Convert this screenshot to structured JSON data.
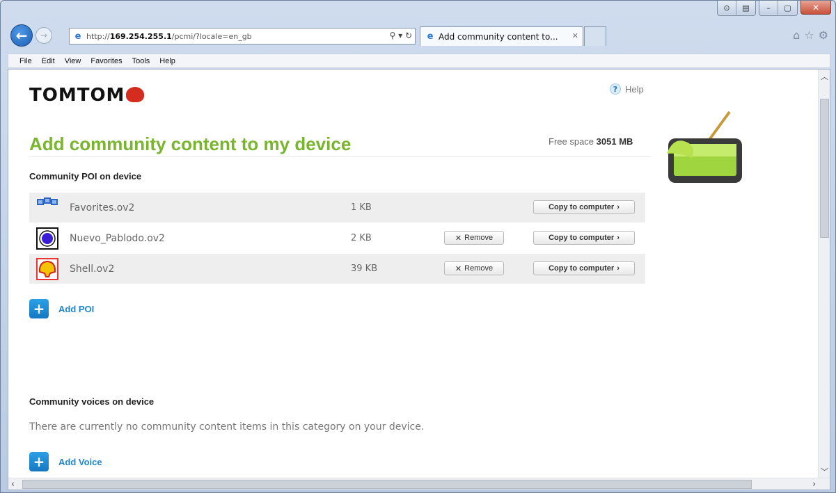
{
  "browser": {
    "address_prefix": "http://",
    "address_host": "169.254.255.1",
    "address_path": "/pcmi/?locale=en_gb",
    "tab_title": "Add community content to...",
    "menu": [
      "File",
      "Edit",
      "View",
      "Favorites",
      "Tools",
      "Help"
    ]
  },
  "page": {
    "logo": "TOMTOM",
    "help": "Help",
    "title": "Add community content to my device",
    "free_space_label": "Free space",
    "free_space_value": "3051 MB",
    "poi_section": "Community POI on device",
    "poi_items": [
      {
        "name": "Favorites.ov2",
        "size": "1 KB",
        "icon": "favorites-poi-icon",
        "removable": false
      },
      {
        "name": "Nuevo_Pablodo.ov2",
        "size": "2 KB",
        "icon": "circle-poi-icon",
        "removable": true
      },
      {
        "name": "Shell.ov2",
        "size": "39 KB",
        "icon": "shell-poi-icon",
        "removable": true
      }
    ],
    "remove_label": "Remove",
    "copy_label": "Copy to computer",
    "add_poi": "Add POI",
    "voices_section": "Community voices on device",
    "voices_empty": "There are currently no community content items in this category on your device.",
    "add_voice": "Add Voice"
  },
  "colors": {
    "title_green": "#7ab52e",
    "link_blue": "#1d86d1",
    "brand_red": "#d42c1e"
  }
}
